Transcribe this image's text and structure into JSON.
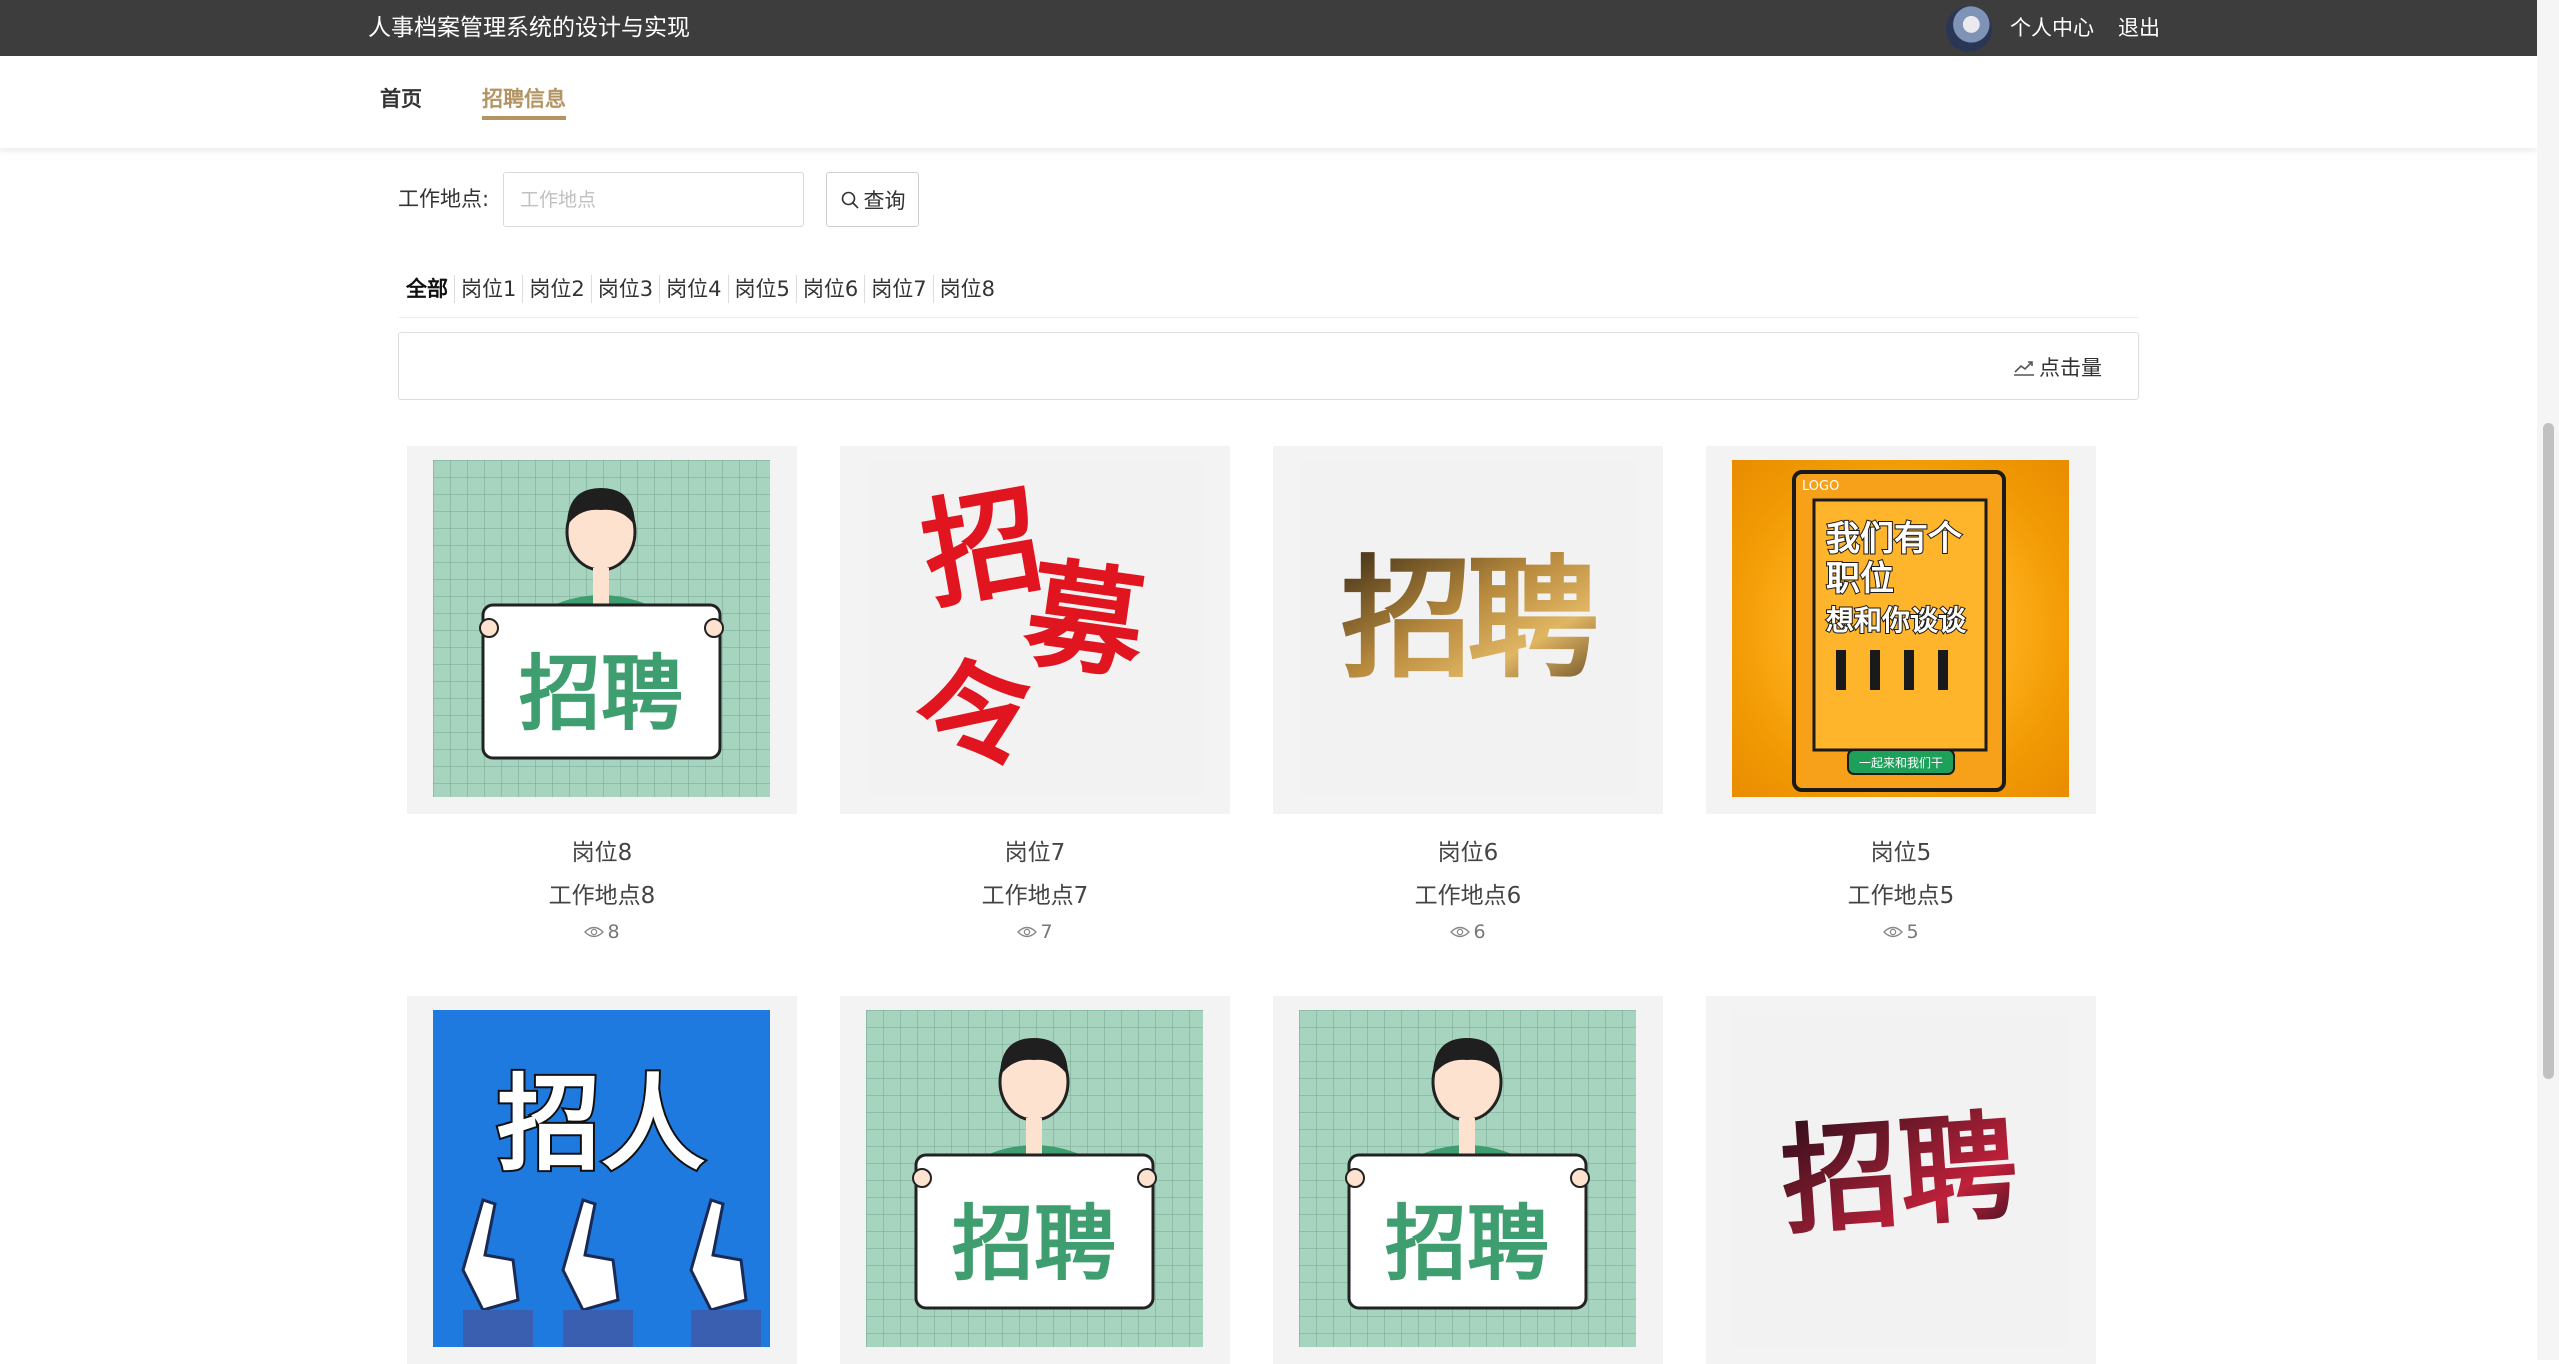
{
  "header": {
    "app_title": "人事档案管理系统的设计与实现",
    "profile_link": "个人中心",
    "logout_link": "退出"
  },
  "nav": {
    "items": [
      {
        "label": "首页",
        "active": false
      },
      {
        "label": "招聘信息",
        "active": true
      }
    ],
    "active_color": "#b39463"
  },
  "search": {
    "label": "工作地点:",
    "placeholder": "工作地点",
    "value": "",
    "button_label": "查询"
  },
  "categories": [
    "全部",
    "岗位1",
    "岗位2",
    "岗位3",
    "岗位4",
    "岗位5",
    "岗位6",
    "岗位7",
    "岗位8"
  ],
  "sort": {
    "label": "点击量"
  },
  "cards": [
    {
      "name": "岗位8",
      "location": "工作地点8",
      "views": "8",
      "image": "hiring-sign-green"
    },
    {
      "name": "岗位7",
      "location": "工作地点7",
      "views": "7",
      "image": "red-calligraphy-recruitment"
    },
    {
      "name": "岗位6",
      "location": "工作地点6",
      "views": "6",
      "image": "gold-hiring-text"
    },
    {
      "name": "岗位5",
      "location": "工作地点5",
      "views": "5",
      "image": "orange-poster"
    },
    {
      "name": "",
      "location": "",
      "views": "",
      "image": "blue-hiring-hands"
    },
    {
      "name": "",
      "location": "",
      "views": "",
      "image": "hiring-sign-green"
    },
    {
      "name": "",
      "location": "",
      "views": "",
      "image": "hiring-sign-green"
    },
    {
      "name": "",
      "location": "",
      "views": "",
      "image": "red-galaxy-hiring-text"
    }
  ],
  "images": {
    "hiring_sign_text": "招聘",
    "calligraphy_text_1": "招",
    "calligraphy_text_2": "募",
    "calligraphy_text_3": "令",
    "gold_text": "招聘",
    "poster_logo": "LOGO",
    "poster_line1": "我们有个",
    "poster_line2": "职位",
    "poster_line3": "想和你谈谈",
    "poster_button": "一起来和我们干",
    "blue_text": "招人",
    "galaxy_text": "招聘"
  }
}
